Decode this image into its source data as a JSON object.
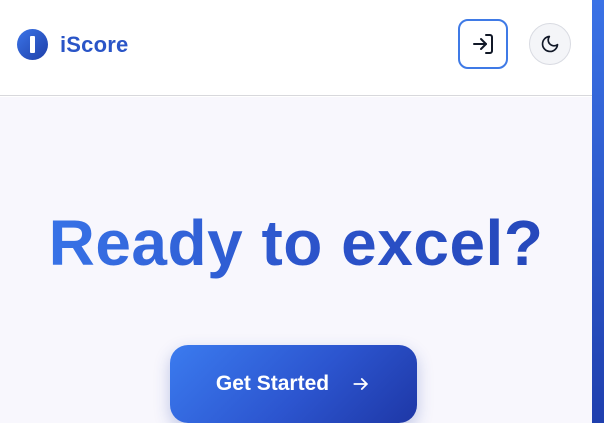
{
  "header": {
    "brand": "iScore",
    "login_icon": "login-icon",
    "theme_icon": "moon-icon"
  },
  "hero": {
    "headline": "Ready to excel?",
    "cta_label": "Get Started",
    "cta_icon": "arrow-right-icon"
  },
  "colors": {
    "brand_blue": "#2a55c7",
    "gradient_start": "#3b7bef",
    "gradient_end": "#1e37a6",
    "hero_background": "#f8f7fd"
  }
}
